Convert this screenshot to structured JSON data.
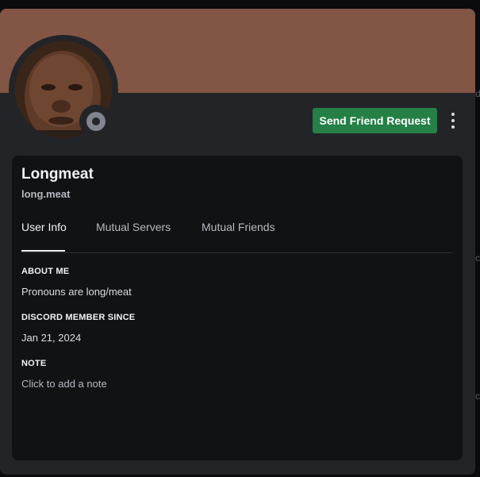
{
  "background": {
    "edge_text_1": "d",
    "edge_text_2": "c",
    "edge_text_3": "c"
  },
  "profile": {
    "banner_color": "#825545",
    "display_name": "Longmeat",
    "username": "long.meat",
    "status": "offline"
  },
  "actions": {
    "send_friend_request_label": "Send Friend Request",
    "more_icon": "vertical-ellipsis-icon"
  },
  "tabs": [
    {
      "label": "User Info",
      "active": true
    },
    {
      "label": "Mutual Servers",
      "active": false
    },
    {
      "label": "Mutual Friends",
      "active": false
    }
  ],
  "about": {
    "title": "ABOUT ME",
    "text": "Pronouns are long/meat"
  },
  "member_since": {
    "title": "DISCORD MEMBER SINCE",
    "date": "Jan 21, 2024"
  },
  "note": {
    "title": "NOTE",
    "placeholder": "Click to add a note"
  },
  "colors": {
    "accent_green": "#248046",
    "card_bg": "#232428",
    "inner_bg": "#111214"
  }
}
